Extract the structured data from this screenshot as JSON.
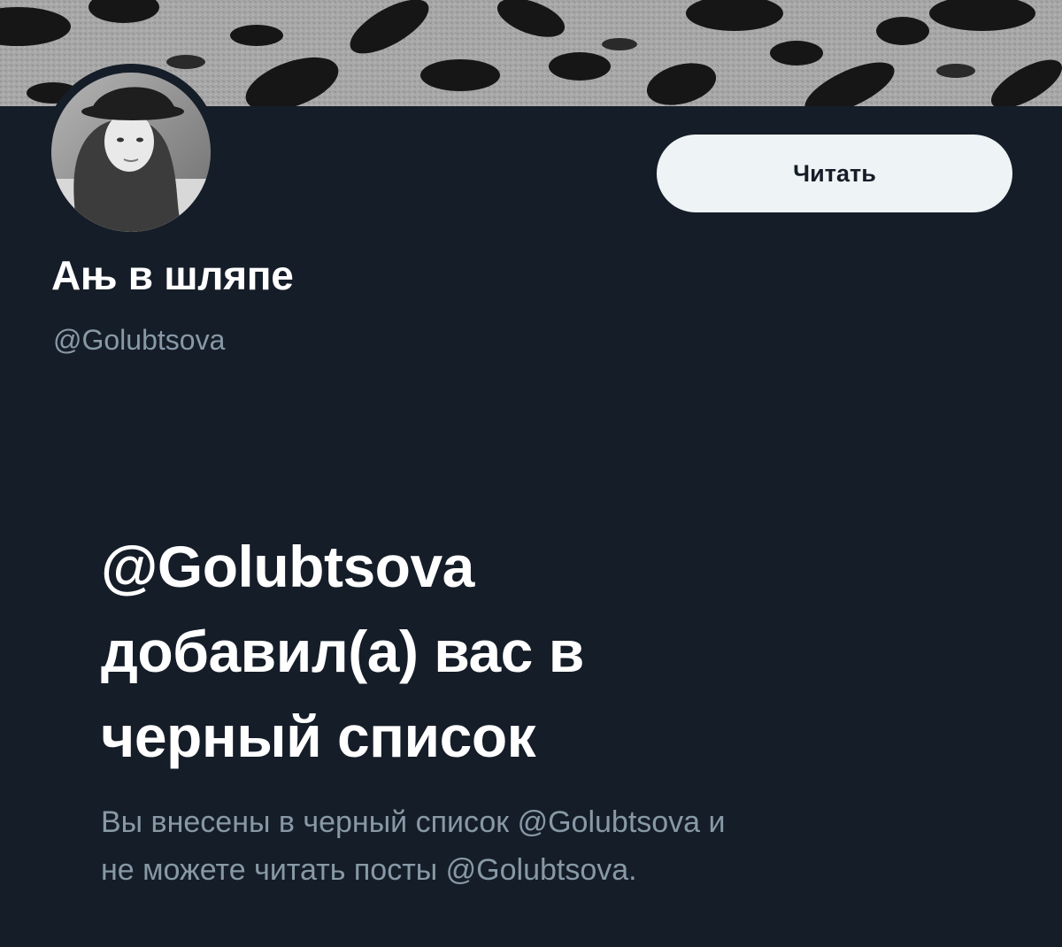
{
  "profile": {
    "display_name": "Ањ в шляпе",
    "handle": "@Golubtsova",
    "follow_label": "Читать"
  },
  "blocked": {
    "title_lines": [
      "@Golubtsova",
      "добавил(а) вас в",
      "черный список"
    ],
    "desc_lines": [
      "Вы внесены в черный список @Golubtsova и",
      "не можете читать посты @Golubtsova."
    ]
  },
  "colors": {
    "background": "#151d28",
    "button_bg": "#eef3f5",
    "muted_text": "#8899a6"
  }
}
